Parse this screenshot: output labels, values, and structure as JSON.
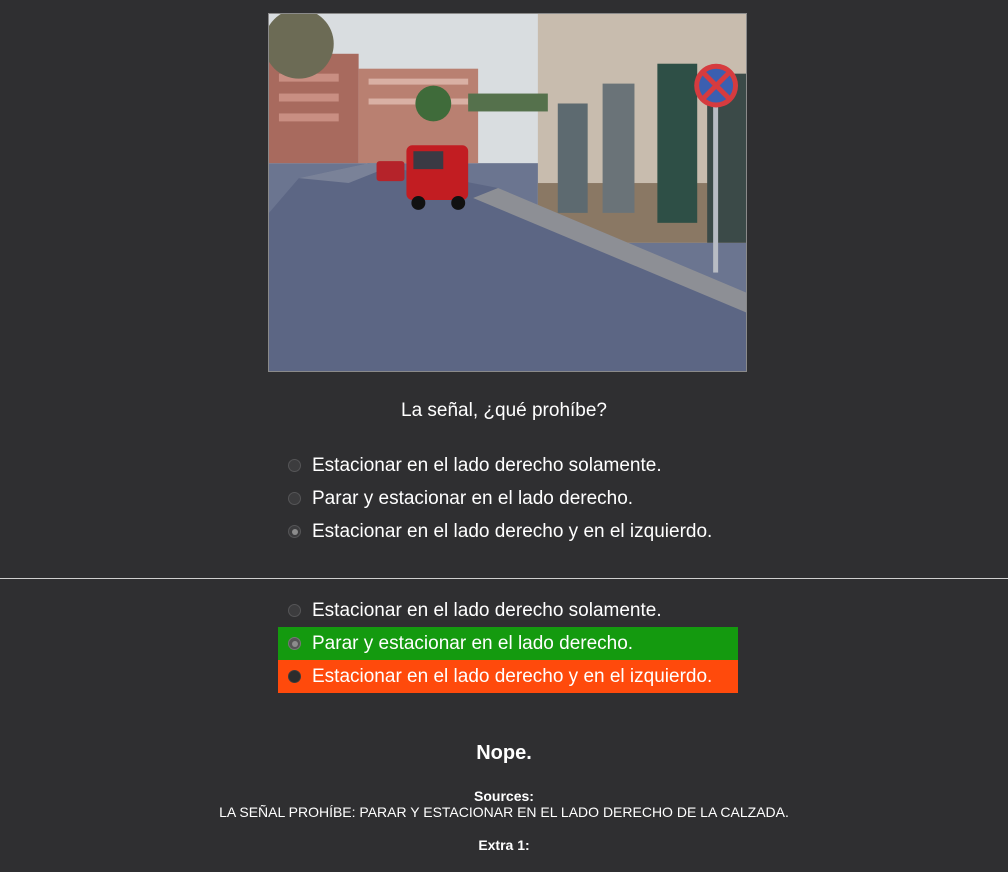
{
  "question": {
    "text": "La señal, ¿qué prohíbe?",
    "image_alt": "street-photo"
  },
  "options": [
    {
      "label": "Estacionar en el lado derecho solamente.",
      "selected": false
    },
    {
      "label": "Parar y estacionar en el lado derecho.",
      "selected": false
    },
    {
      "label": "Estacionar en el lado derecho y en el izquierdo.",
      "selected": true
    }
  ],
  "results": [
    {
      "label": "Estacionar en el lado derecho solamente.",
      "status": "neutral"
    },
    {
      "label": "Parar y estacionar en el lado derecho.",
      "status": "correct"
    },
    {
      "label": "Estacionar en el lado derecho y en el izquierdo.",
      "status": "wrong"
    }
  ],
  "feedback": {
    "verdict": "Nope.",
    "sources_label": "Sources:",
    "sources_text": "LA SEÑAL PROHÍBE: PARAR Y ESTACIONAR EN EL LADO DERECHO DE LA CALZADA.",
    "extra_label": "Extra 1:"
  },
  "colors": {
    "background": "#2f2f31",
    "correct": "#149a0f",
    "wrong": "#ff4a0c",
    "divider": "#cfcfcf"
  }
}
